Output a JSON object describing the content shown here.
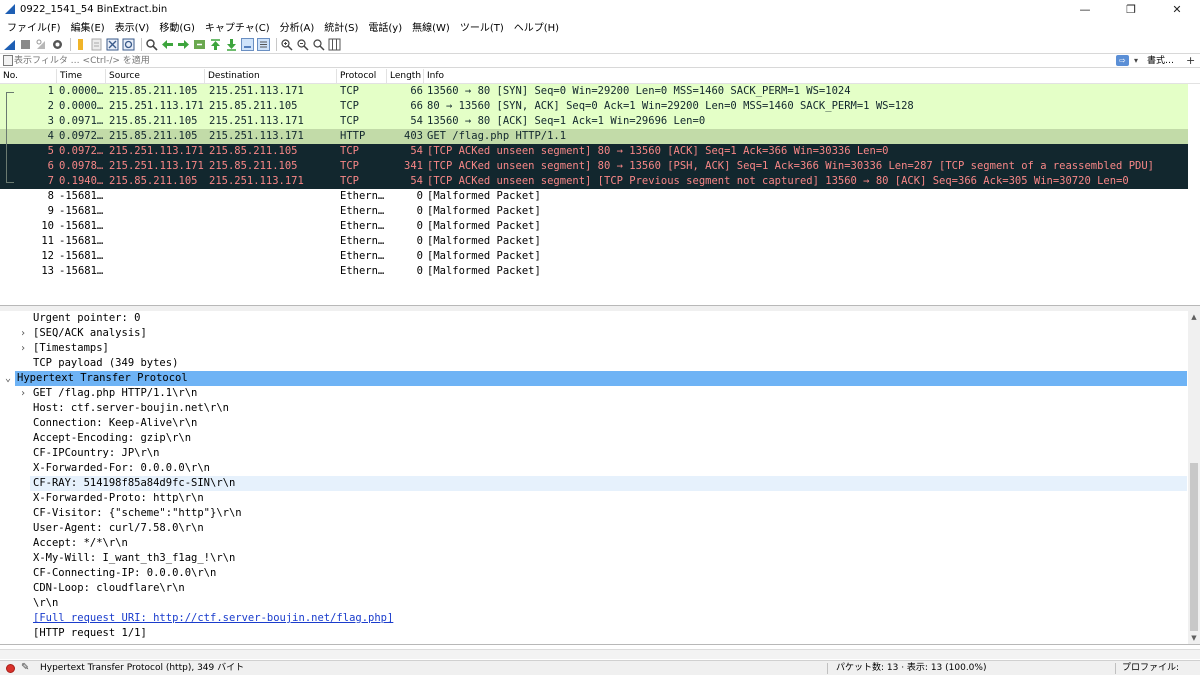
{
  "window": {
    "title": "0922_1541_54 BinExtract.bin",
    "minimize": "—",
    "maximize": "❐",
    "close": "✕"
  },
  "menu": [
    "ファイル(F)",
    "編集(E)",
    "表示(V)",
    "移動(G)",
    "キャプチャ(C)",
    "分析(A)",
    "統計(S)",
    "電話(y)",
    "無線(W)",
    "ツール(T)",
    "ヘルプ(H)"
  ],
  "filter": {
    "placeholder": "表示フィルタ … <Ctrl-/> を適用",
    "arrow": "⇨",
    "dropdown": "▾",
    "format_label": "書式…",
    "add": "+"
  },
  "columns": {
    "no": "No.",
    "time": "Time",
    "source": "Source",
    "destination": "Destination",
    "protocol": "Protocol",
    "length": "Length",
    "info": "Info"
  },
  "packets": [
    {
      "no": "1",
      "time": "0.0000…",
      "source": "215.85.211.105",
      "destination": "215.251.113.171",
      "protocol": "TCP",
      "length": "66",
      "info": "13560 → 80 [SYN] Seq=0 Win=29200 Len=0 MSS=1460 SACK_PERM=1 WS=1024",
      "style": "green"
    },
    {
      "no": "2",
      "time": "0.0000…",
      "source": "215.251.113.171",
      "destination": "215.85.211.105",
      "protocol": "TCP",
      "length": "66",
      "info": "80 → 13560 [SYN, ACK] Seq=0 Ack=1 Win=29200 Len=0 MSS=1460 SACK_PERM=1 WS=128",
      "style": "green"
    },
    {
      "no": "3",
      "time": "0.0971…",
      "source": "215.85.211.105",
      "destination": "215.251.113.171",
      "protocol": "TCP",
      "length": "54",
      "info": "13560 → 80 [ACK] Seq=1 Ack=1 Win=29696 Len=0",
      "style": "green"
    },
    {
      "no": "4",
      "time": "0.0972…",
      "source": "215.85.211.105",
      "destination": "215.251.113.171",
      "protocol": "HTTP",
      "length": "403",
      "info": "GET /flag.php HTTP/1.1",
      "style": "sel"
    },
    {
      "no": "5",
      "time": "0.0972…",
      "source": "215.251.113.171",
      "destination": "215.85.211.105",
      "protocol": "TCP",
      "length": "54",
      "info": "[TCP ACKed unseen segment] 80 → 13560 [ACK] Seq=1 Ack=366 Win=30336 Len=0",
      "style": "dark"
    },
    {
      "no": "6",
      "time": "0.0978…",
      "source": "215.251.113.171",
      "destination": "215.85.211.105",
      "protocol": "TCP",
      "length": "341",
      "info": "[TCP ACKed unseen segment] 80 → 13560 [PSH, ACK] Seq=1 Ack=366 Win=30336 Len=287 [TCP segment of a reassembled PDU]",
      "style": "dark"
    },
    {
      "no": "7",
      "time": "0.1940…",
      "source": "215.85.211.105",
      "destination": "215.251.113.171",
      "protocol": "TCP",
      "length": "54",
      "info": "[TCP ACKed unseen segment] [TCP Previous segment not captured] 13560 → 80 [ACK] Seq=366 Ack=305 Win=30720 Len=0",
      "style": "dark"
    },
    {
      "no": "8",
      "time": "-15681…",
      "source": "",
      "destination": "",
      "protocol": "Ethern…",
      "length": "0",
      "info": "[Malformed Packet]",
      "style": "plain"
    },
    {
      "no": "9",
      "time": "-15681…",
      "source": "",
      "destination": "",
      "protocol": "Ethern…",
      "length": "0",
      "info": "[Malformed Packet]",
      "style": "plain"
    },
    {
      "no": "10",
      "time": "-15681…",
      "source": "",
      "destination": "",
      "protocol": "Ethern…",
      "length": "0",
      "info": "[Malformed Packet]",
      "style": "plain"
    },
    {
      "no": "11",
      "time": "-15681…",
      "source": "",
      "destination": "",
      "protocol": "Ethern…",
      "length": "0",
      "info": "[Malformed Packet]",
      "style": "plain"
    },
    {
      "no": "12",
      "time": "-15681…",
      "source": "",
      "destination": "",
      "protocol": "Ethern…",
      "length": "0",
      "info": "[Malformed Packet]",
      "style": "plain"
    },
    {
      "no": "13",
      "time": "-15681…",
      "source": "",
      "destination": "",
      "protocol": "Ethern…",
      "length": "0",
      "info": "[Malformed Packet]",
      "style": "plain"
    }
  ],
  "details": [
    {
      "text": "Urgent pointer: 0",
      "indent": 2,
      "arrow": "",
      "style": ""
    },
    {
      "text": "[SEQ/ACK analysis]",
      "indent": 2,
      "arrow": "›",
      "style": ""
    },
    {
      "text": "[Timestamps]",
      "indent": 2,
      "arrow": "›",
      "style": ""
    },
    {
      "text": "TCP payload (349 bytes)",
      "indent": 2,
      "arrow": "",
      "style": ""
    },
    {
      "text": "Hypertext Transfer Protocol",
      "indent": 1,
      "arrow": "⌄",
      "style": "hl"
    },
    {
      "text": "GET /flag.php HTTP/1.1\\r\\n",
      "indent": 2,
      "arrow": "›",
      "style": ""
    },
    {
      "text": "Host: ctf.server-boujin.net\\r\\n",
      "indent": 2,
      "arrow": "",
      "style": ""
    },
    {
      "text": "Connection: Keep-Alive\\r\\n",
      "indent": 2,
      "arrow": "",
      "style": ""
    },
    {
      "text": "Accept-Encoding: gzip\\r\\n",
      "indent": 2,
      "arrow": "",
      "style": ""
    },
    {
      "text": "CF-IPCountry: JP\\r\\n",
      "indent": 2,
      "arrow": "",
      "style": ""
    },
    {
      "text": "X-Forwarded-For: 0.0.0.0\\r\\n",
      "indent": 2,
      "arrow": "",
      "style": ""
    },
    {
      "text": "CF-RAY: 514198f85a84d9fc-SIN\\r\\n",
      "indent": 2,
      "arrow": "",
      "style": "hl2"
    },
    {
      "text": "X-Forwarded-Proto: http\\r\\n",
      "indent": 2,
      "arrow": "",
      "style": ""
    },
    {
      "text": "CF-Visitor: {\"scheme\":\"http\"}\\r\\n",
      "indent": 2,
      "arrow": "",
      "style": ""
    },
    {
      "text": "User-Agent: curl/7.58.0\\r\\n",
      "indent": 2,
      "arrow": "",
      "style": ""
    },
    {
      "text": "Accept: */*\\r\\n",
      "indent": 2,
      "arrow": "",
      "style": ""
    },
    {
      "text": "X-My-Will: I_want_th3_f1ag_!\\r\\n",
      "indent": 2,
      "arrow": "",
      "style": ""
    },
    {
      "text": "CF-Connecting-IP: 0.0.0.0\\r\\n",
      "indent": 2,
      "arrow": "",
      "style": ""
    },
    {
      "text": "CDN-Loop: cloudflare\\r\\n",
      "indent": 2,
      "arrow": "",
      "style": ""
    },
    {
      "text": "\\r\\n",
      "indent": 2,
      "arrow": "",
      "style": ""
    },
    {
      "text": "[Full request URI: http://ctf.server-boujin.net/flag.php]",
      "indent": 2,
      "arrow": "",
      "style": "link"
    },
    {
      "text": "[HTTP request 1/1]",
      "indent": 2,
      "arrow": "",
      "style": ""
    }
  ],
  "status": {
    "edit_icon": "✎",
    "field": "Hypertext Transfer Protocol (http), 349 バイト",
    "count": "パケット数: 13 · 表示: 13 (100.0%)",
    "profile": "プロファイル: Default"
  },
  "colors": {
    "row_green": "#e4ffc7",
    "row_selected": "#c2dba8",
    "row_dark": "#12272e",
    "row_dark_text": "#f78787",
    "detail_highlight": "#6eb3f5",
    "link": "#1a3ccc"
  },
  "icons": [
    "shark-fin-start-icon",
    "stop-icon",
    "restart-icon",
    "options-gear-icon",
    "open-file-icon",
    "save-icon",
    "close-file-icon",
    "reload-icon",
    "find-icon",
    "back-arrow-icon",
    "forward-arrow-icon",
    "goto-packet-icon",
    "first-packet-icon",
    "last-packet-icon",
    "autoscroll-icon",
    "colorize-icon",
    "zoom-in-icon",
    "zoom-out-icon",
    "zoom-normal-icon",
    "resize-columns-icon"
  ]
}
